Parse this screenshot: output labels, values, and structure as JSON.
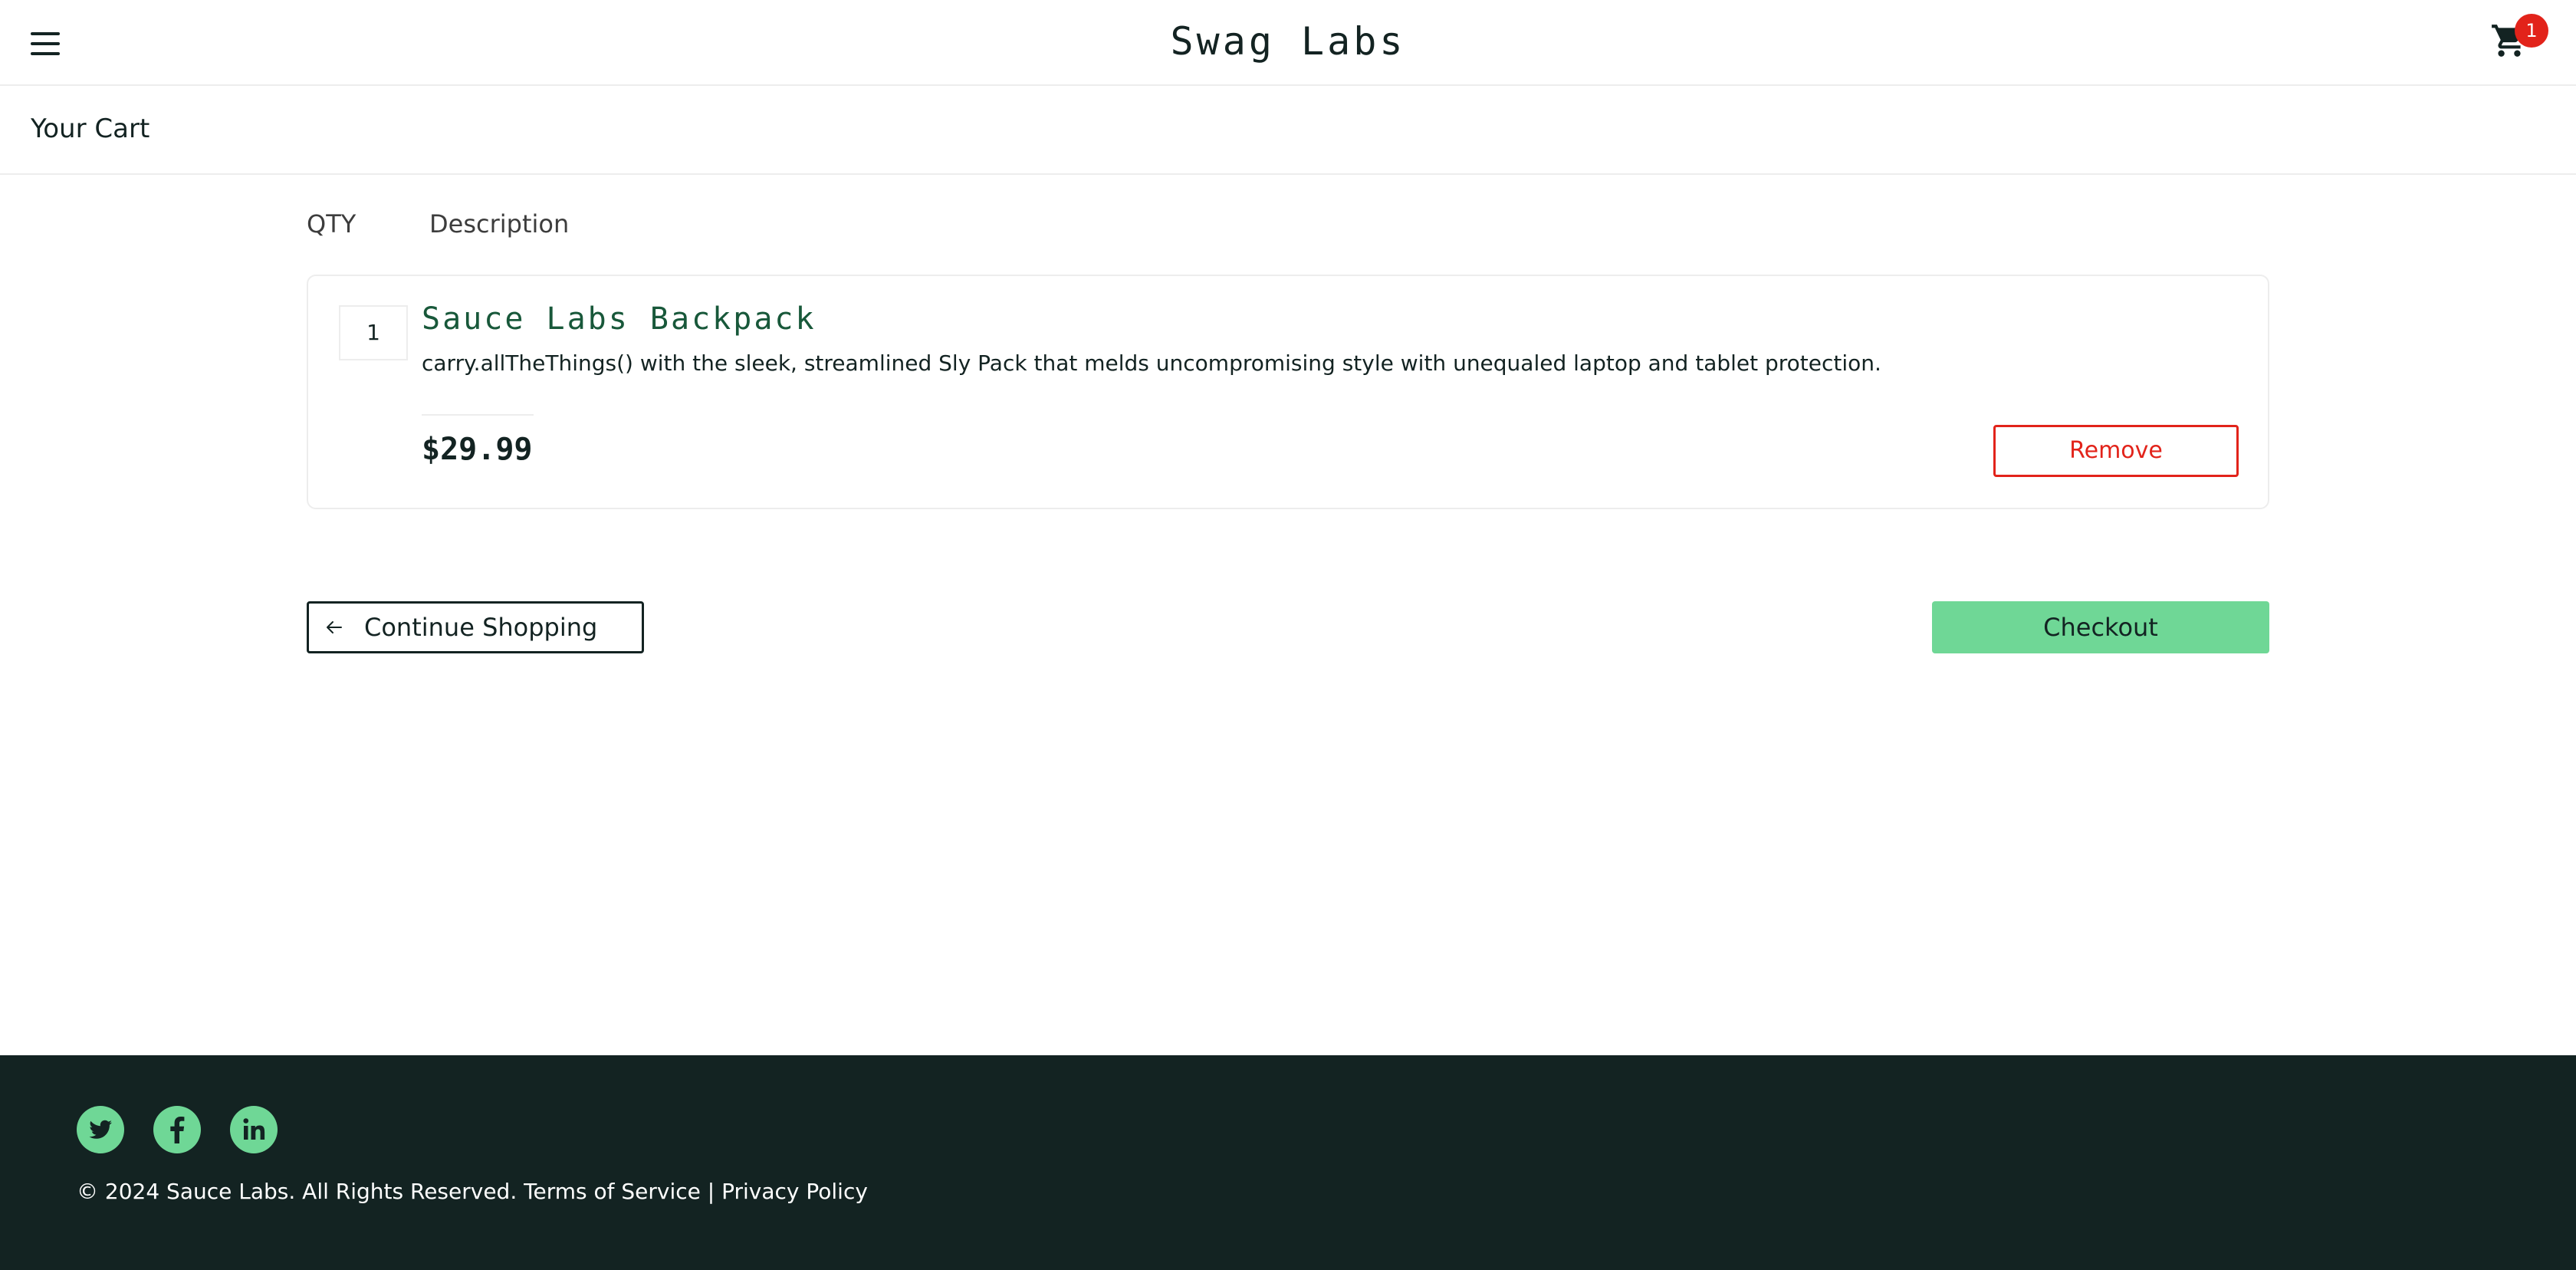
{
  "header": {
    "app_title": "Swag Labs",
    "menu_icon": "hamburger-menu-icon",
    "cart_icon": "shopping-cart-icon",
    "cart_badge_count": "1"
  },
  "secondary_header": {
    "title": "Your Cart"
  },
  "cart_list": {
    "qty_label": "QTY",
    "desc_label": "Description",
    "items": [
      {
        "quantity": "1",
        "name": "Sauce Labs Backpack",
        "description": "carry.allTheThings() with the sleek, streamlined Sly Pack that melds uncompromising style with unequaled laptop and tablet protection.",
        "price": "$29.99",
        "remove_label": "Remove"
      }
    ]
  },
  "actions": {
    "continue_label": "Continue Shopping",
    "continue_icon": "arrow-left-icon",
    "checkout_label": "Checkout"
  },
  "footer": {
    "social": [
      {
        "name": "Twitter",
        "icon": "twitter-icon"
      },
      {
        "name": "Facebook",
        "icon": "facebook-icon"
      },
      {
        "name": "LinkedIn",
        "icon": "linkedin-icon"
      }
    ],
    "copyright": "© 2024 Sauce Labs. All Rights Reserved. Terms of Service | Privacy Policy"
  },
  "colors": {
    "text": "#132322",
    "brand_green": "#6fd796",
    "item_name": "#18583a",
    "remove_red": "#e2231a",
    "badge_red": "#e2231a",
    "footer_bg": "#132322",
    "border": "#ededed"
  }
}
